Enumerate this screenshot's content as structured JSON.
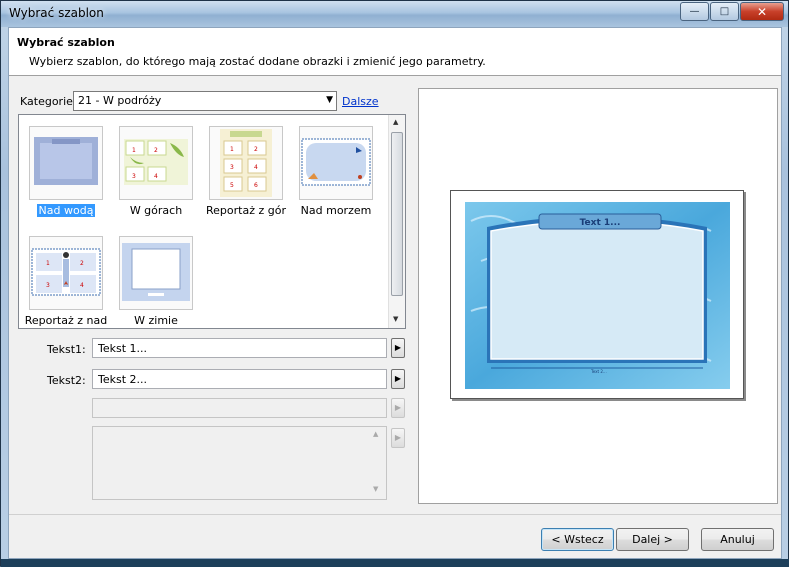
{
  "window": {
    "title": "Wybrać szablon",
    "controls": {
      "minimize": "—",
      "maximize": "□",
      "close": "✕"
    }
  },
  "header": {
    "title": "Wybrać szablon",
    "subtitle": "Wybierz szablon, do którego mają zostać dodane obrazki i zmienić jego parametry."
  },
  "category": {
    "label": "Kategorie:",
    "selected": "21 - W podróży",
    "more_link": "Dalsze"
  },
  "templates": [
    {
      "label": "Nad wodą",
      "selected": true
    },
    {
      "label": "W górach",
      "selected": false
    },
    {
      "label": "Reportaż z gór",
      "selected": false
    },
    {
      "label": "Nad morzem",
      "selected": false
    },
    {
      "label": "Reportaż z nad",
      "selected": false
    },
    {
      "label": "W zimie",
      "selected": false
    }
  ],
  "thumb_text": {
    "n1": "1",
    "n2": "2",
    "n3": "3",
    "n4": "4",
    "n5": "5",
    "n6": "6"
  },
  "fields": {
    "tekst1_label": "Tekst1:",
    "tekst1_value": "Tekst 1...",
    "tekst2_label": "Tekst2:",
    "tekst2_value": "Tekst 2..."
  },
  "preview": {
    "title_text": "Text 1...",
    "footer_text": "Text 2..."
  },
  "buttons": {
    "back": "< Wstecz",
    "next": "Dalej >",
    "cancel": "Anuluj"
  },
  "colors": {
    "accent_selection": "#3399ff",
    "water_blue": "#5ab4e0",
    "link": "#0033cc"
  }
}
